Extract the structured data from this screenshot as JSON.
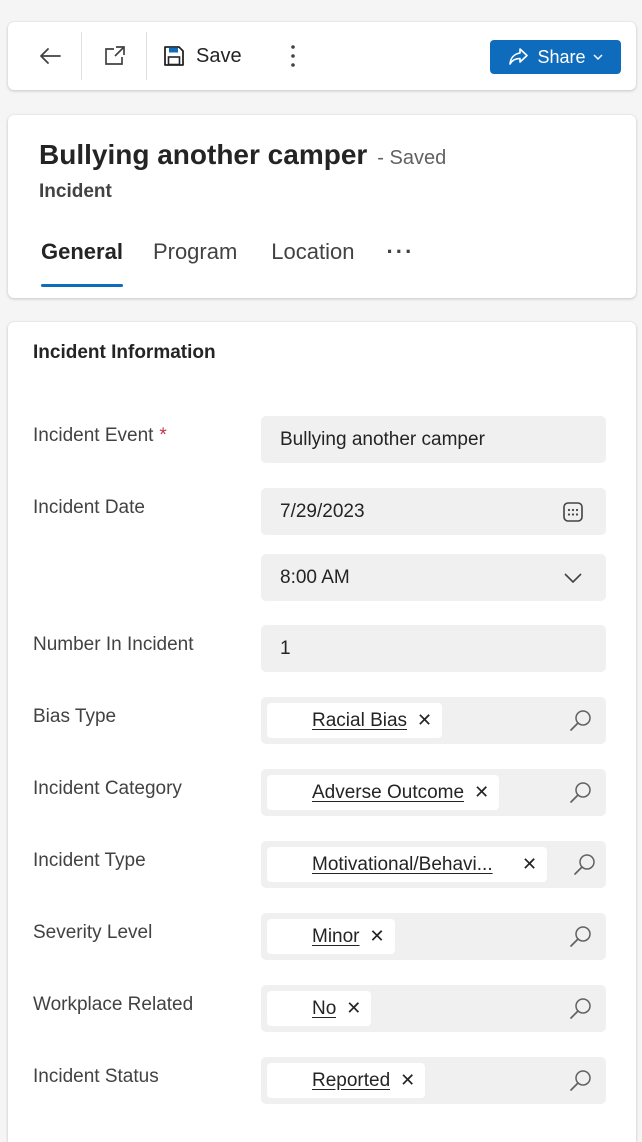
{
  "toolbar": {
    "back_icon": "arrow-left-icon",
    "open_new_window_icon": "open-in-new-window-icon",
    "save_icon": "floppy-disk-icon",
    "save_label": "Save",
    "more_icon": "vertical-ellipsis-icon",
    "share_label": "Share",
    "share_icon": "share-icon",
    "share_chevron_icon": "chevron-down-icon",
    "accent_color": "#0f6cbd"
  },
  "header": {
    "title": "Bullying another camper",
    "status": "- Saved",
    "entity": "Incident",
    "tabs": [
      {
        "label": "General",
        "active": true
      },
      {
        "label": "Program",
        "active": false
      },
      {
        "label": "Location",
        "active": false
      },
      {
        "label": "···",
        "active": false
      }
    ]
  },
  "form": {
    "section_title": "Incident Information",
    "incident_event": {
      "label": "Incident Event",
      "required_mark": "*",
      "value": "Bullying another camper"
    },
    "incident_date": {
      "label": "Incident Date",
      "date_value": "7/29/2023",
      "time_value": "8:00 AM",
      "calendar_icon": "calendar-icon"
    },
    "number_in_incident": {
      "label": "Number In Incident",
      "value": "1"
    },
    "lookups": [
      {
        "label": "Bias Type",
        "value": "Racial Bias"
      },
      {
        "label": "Incident Category",
        "value": "Adverse Outcome"
      },
      {
        "label": "Incident Type",
        "value": "Motivational/Behavi..."
      },
      {
        "label": "Severity Level",
        "value": "Minor"
      },
      {
        "label": "Workplace Related",
        "value": "No"
      },
      {
        "label": "Incident Status",
        "value": "Reported"
      }
    ],
    "remove_symbol": "✕",
    "search_icon": "search-icon"
  }
}
